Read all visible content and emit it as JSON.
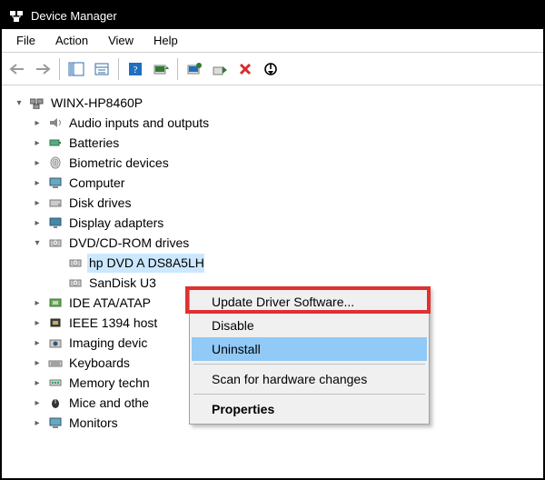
{
  "window": {
    "title": "Device Manager"
  },
  "menu": {
    "file": "File",
    "action": "Action",
    "view": "View",
    "help": "Help"
  },
  "tree": {
    "root": "WINX-HP8460P",
    "audio": "Audio inputs and outputs",
    "batteries": "Batteries",
    "biometric": "Biometric devices",
    "computer": "Computer",
    "disk": "Disk drives",
    "display": "Display adapters",
    "dvd": "DVD/CD-ROM drives",
    "dvd_child1": "hp DVD A  DS8A5LH",
    "dvd_child2": "SanDisk U3",
    "ide": "IDE ATA/ATAP",
    "ieee": "IEEE 1394 host",
    "imaging": "Imaging devic",
    "keyboards": "Keyboards",
    "memory": "Memory techn",
    "mice": "Mice and othe",
    "monitors": "Monitors"
  },
  "context_menu": {
    "update": "Update Driver Software...",
    "disable": "Disable",
    "uninstall": "Uninstall",
    "scan": "Scan for hardware changes",
    "properties": "Properties"
  }
}
